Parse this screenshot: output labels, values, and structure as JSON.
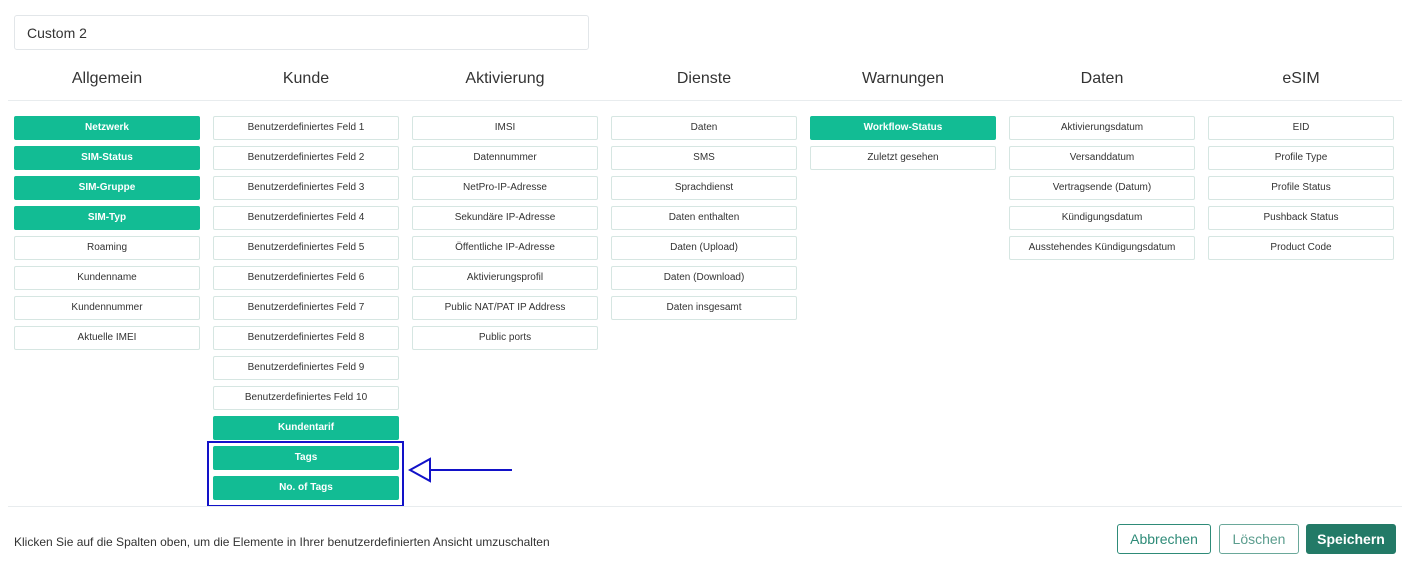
{
  "view_name": "Custom 2",
  "columns": [
    {
      "header": "Allgemein",
      "items": [
        {
          "label": "Netzwerk",
          "active": true
        },
        {
          "label": "SIM-Status",
          "active": true
        },
        {
          "label": "SIM-Gruppe",
          "active": true
        },
        {
          "label": "SIM-Typ",
          "active": true
        },
        {
          "label": "Roaming",
          "active": false
        },
        {
          "label": "Kundenname",
          "active": false
        },
        {
          "label": "Kundennummer",
          "active": false
        },
        {
          "label": "Aktuelle IMEI",
          "active": false
        }
      ]
    },
    {
      "header": "Kunde",
      "items": [
        {
          "label": "Benutzerdefiniertes Feld 1",
          "active": false
        },
        {
          "label": "Benutzerdefiniertes Feld 2",
          "active": false
        },
        {
          "label": "Benutzerdefiniertes Feld 3",
          "active": false
        },
        {
          "label": "Benutzerdefiniertes Feld 4",
          "active": false
        },
        {
          "label": "Benutzerdefiniertes Feld 5",
          "active": false
        },
        {
          "label": "Benutzerdefiniertes Feld 6",
          "active": false
        },
        {
          "label": "Benutzerdefiniertes Feld 7",
          "active": false
        },
        {
          "label": "Benutzerdefiniertes Feld 8",
          "active": false
        },
        {
          "label": "Benutzerdefiniertes Feld 9",
          "active": false
        },
        {
          "label": "Benutzerdefiniertes Feld 10",
          "active": false
        },
        {
          "label": "Kundentarif",
          "active": true
        },
        {
          "label": "Tags",
          "active": true
        },
        {
          "label": "No. of Tags",
          "active": true
        }
      ]
    },
    {
      "header": "Aktivierung",
      "items": [
        {
          "label": "IMSI",
          "active": false
        },
        {
          "label": "Datennummer",
          "active": false
        },
        {
          "label": "NetPro-IP-Adresse",
          "active": false
        },
        {
          "label": "Sekundäre IP-Adresse",
          "active": false
        },
        {
          "label": "Öffentliche IP-Adresse",
          "active": false
        },
        {
          "label": "Aktivierungsprofil",
          "active": false
        },
        {
          "label": "Public NAT/PAT IP Address",
          "active": false
        },
        {
          "label": "Public ports",
          "active": false
        }
      ]
    },
    {
      "header": "Dienste",
      "items": [
        {
          "label": "Daten",
          "active": false
        },
        {
          "label": "SMS",
          "active": false
        },
        {
          "label": "Sprachdienst",
          "active": false
        },
        {
          "label": "Daten enthalten",
          "active": false
        },
        {
          "label": "Daten (Upload)",
          "active": false
        },
        {
          "label": "Daten (Download)",
          "active": false
        },
        {
          "label": "Daten insgesamt",
          "active": false
        }
      ]
    },
    {
      "header": "Warnungen",
      "items": [
        {
          "label": "Workflow-Status",
          "active": true
        },
        {
          "label": "Zuletzt gesehen",
          "active": false
        }
      ]
    },
    {
      "header": "Daten",
      "items": [
        {
          "label": "Aktivierungsdatum",
          "active": false
        },
        {
          "label": "Versanddatum",
          "active": false
        },
        {
          "label": "Vertragsende (Datum)",
          "active": false
        },
        {
          "label": "Kündigungsdatum",
          "active": false
        },
        {
          "label": "Ausstehendes Kündigungsdatum",
          "active": false
        }
      ]
    },
    {
      "header": "eSIM",
      "items": [
        {
          "label": "EID",
          "active": false
        },
        {
          "label": "Profile Type",
          "active": false
        },
        {
          "label": "Profile Status",
          "active": false
        },
        {
          "label": "Pushback Status",
          "active": false
        },
        {
          "label": "Product Code",
          "active": false
        }
      ]
    }
  ],
  "footer": {
    "hint": "Klicken Sie auf die Spalten oben, um die Elemente in Ihrer benutzerdefinierten Ansicht umzuschalten",
    "cancel_label": "Abbrechen",
    "delete_label": "Löschen",
    "save_label": "Speichern"
  },
  "colors": {
    "active_green": "#12bc94",
    "primary_button": "#237a67",
    "annotation_blue": "#1212c8"
  },
  "annotation": {
    "highlighted_items": [
      "Tags",
      "No. of Tags"
    ],
    "icon": "left-arrow-icon"
  }
}
